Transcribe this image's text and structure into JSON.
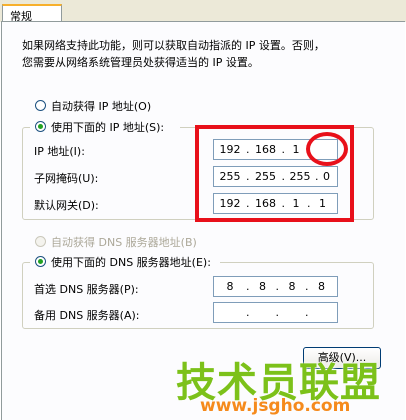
{
  "tab": {
    "label": "常规"
  },
  "description": {
    "line1": "如果网络支持此功能，则可以获取自动指派的 IP 设置。否则，",
    "line2": "您需要从网络系统管理员处获得适当的 IP 设置。"
  },
  "ip_section": {
    "auto_label": "自动获得 IP 地址(O)",
    "manual_label": "使用下面的 IP 地址(S):",
    "selected": "manual",
    "ip_label": "IP 地址(I):",
    "mask_label": "子网掩码(U):",
    "gateway_label": "默认网关(D):",
    "ip": [
      "192",
      "168",
      "1",
      ""
    ],
    "mask": [
      "255",
      "255",
      "255",
      "0"
    ],
    "gateway": [
      "192",
      "168",
      "1",
      "1"
    ]
  },
  "dns_section": {
    "auto_label": "自动获得 DNS 服务器地址(B)",
    "manual_label": "使用下面的 DNS 服务器地址(E):",
    "selected": "manual",
    "preferred_label": "首选 DNS 服务器(P):",
    "alternate_label": "备用 DNS 服务器(A):",
    "preferred": [
      "8",
      "8",
      "8",
      "8"
    ],
    "alternate": [
      "",
      "",
      "",
      ""
    ]
  },
  "advanced_button": {
    "label": "高级(V)..."
  },
  "watermark": {
    "text": "技术员联盟",
    "url": "www.jsgho.com"
  },
  "colors": {
    "highlight": "#e8101a",
    "watermark_green": "#7cc11a",
    "watermark_orange": "#f58a1c"
  }
}
